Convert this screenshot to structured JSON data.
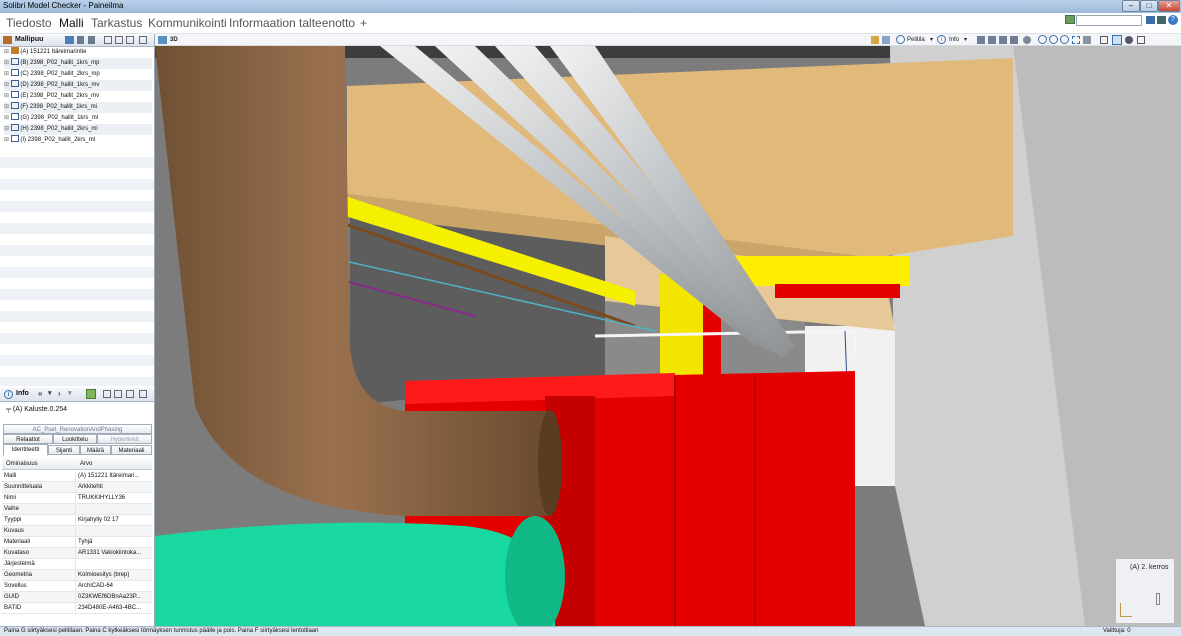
{
  "window": {
    "title": "Solibri Model Checker - Paineilma",
    "buttons": [
      "–",
      "□",
      "✕"
    ]
  },
  "menu": {
    "items": [
      "Tiedosto",
      "Malli",
      "Tarkastus",
      "Kommunikointi",
      "Informaation talteenotto",
      "+"
    ],
    "active": "Malli"
  },
  "model_tree": {
    "title": "Mallipuu",
    "items": [
      "(A) 151221 Itäreimarintie",
      "(B) 2398_P02_hallit_1krs_mp",
      "(C) 2398_P02_hallit_2krs_mp",
      "(D) 2398_P02_hallit_1krs_mv",
      "(E) 2398_P02_hallit_2krs_mv",
      "(F) 2398_P02_hallit_1krs_mi",
      "(G) 2398_P02_hallit_1krs_ml",
      "(H) 2398_P02_hallit_2krs_mi",
      "(I) 2398_P02_hallit_2krs_ml"
    ]
  },
  "info": {
    "title": "Info",
    "selected": "(A) Kaluste.0.254",
    "pset_tab": "AC_Pset_RenovationAndPhasing",
    "tabs_row1": [
      "Relaatiot",
      "Luokittelu",
      "Hyperlinkit"
    ],
    "tabs_row2": [
      "Identiteetti",
      "Sijanti",
      "Määrä",
      "Materiaali"
    ],
    "col_headers": [
      "Ominaisuus",
      "Arvo"
    ],
    "rows": [
      {
        "k": "Malli",
        "v": "(A) 151221 Itäreimari..."
      },
      {
        "k": "Suunnittelualа",
        "v": "Arkkitehti"
      },
      {
        "k": "Nimi",
        "v": "TRUKKIHYLLY36"
      },
      {
        "k": "Vaihe",
        "v": ""
      },
      {
        "k": "Tyyppi",
        "v": "Kirjahylly 02 17"
      },
      {
        "k": "Kuvaus",
        "v": ""
      },
      {
        "k": "Materiaali",
        "v": "Tyhjä"
      },
      {
        "k": "Kuvataso",
        "v": "AR1331 Vakiokiintoka..."
      },
      {
        "k": "Järjestelmä",
        "v": ""
      },
      {
        "k": "Geometria",
        "v": "Kolmioesitys (brep)"
      },
      {
        "k": "Sovellus",
        "v": "ArchiCAD-64"
      },
      {
        "k": "GUID",
        "v": "0Z3KWEf6DBnAa23P..."
      },
      {
        "k": "BATID",
        "v": "234D480E-A463-4BC..."
      }
    ]
  },
  "view3d": {
    "title": "3D",
    "toolbar": {
      "pelitila": "Pelitila",
      "info": "Info"
    },
    "floor_label": "(A) 2. kerros"
  },
  "statusbar": {
    "hint": "Paina G siirtyäksesi pelitilaan. Paina C kytkeäksesi törmäyksen tunnistus päälle ja pois. Paina F siirtyäksesi lentotilaan",
    "selected": "Valittuja: 0"
  }
}
